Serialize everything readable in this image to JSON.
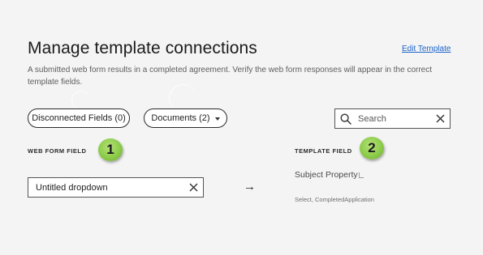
{
  "header": {
    "title": "Manage template connections",
    "edit_link": "Edit Template",
    "description": "A submitted web form results in a completed agreement. Verify the web form responses will appear in the correct template fields."
  },
  "filters": {
    "disconnected_label": "Disconnected Fields (0)",
    "documents_label": "Documents (2)",
    "search_placeholder": "Search"
  },
  "columns": {
    "left_header": "WEB FORM FIELD",
    "right_header": "TEMPLATE FIELD"
  },
  "callouts": {
    "left_number": "1",
    "right_number": "2"
  },
  "mapping": {
    "web_form_field_value": "Untitled dropdown",
    "arrow": "→",
    "template_field": "Subject Property",
    "template_subtext": "Select,  CompletedApplication"
  },
  "icons": {
    "search": "search-icon",
    "clear": "close-icon",
    "dropdown": "caret-down-icon",
    "arrow": "arrow-right-icon"
  },
  "colors": {
    "background": "#f4f4f4",
    "link": "#1a63c9",
    "badge": "#8ccc4a"
  }
}
